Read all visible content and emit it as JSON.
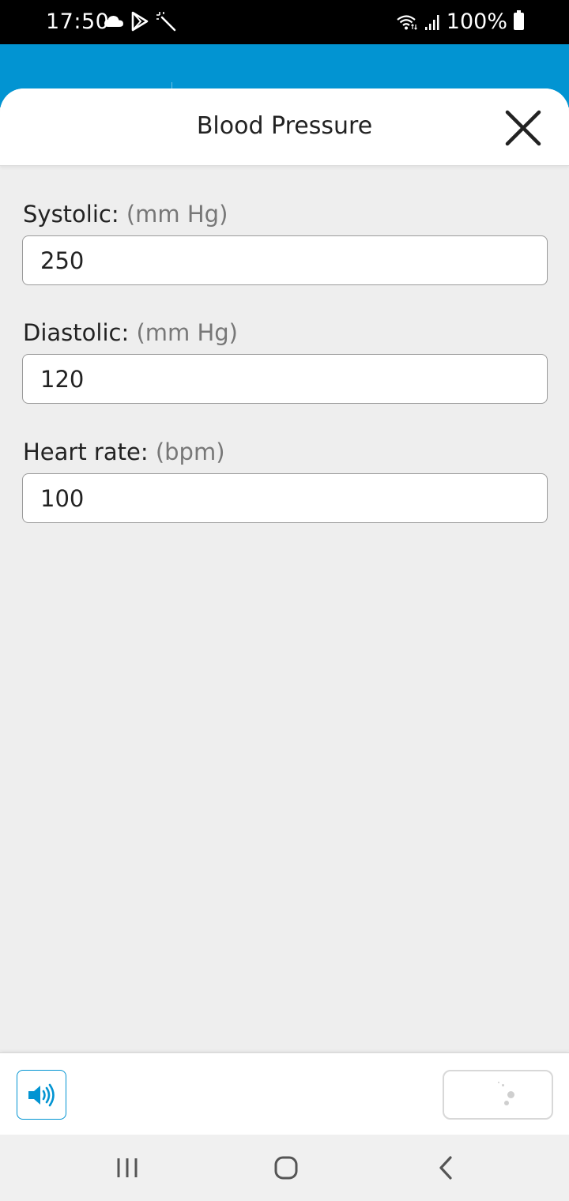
{
  "status_bar": {
    "time": "17:50",
    "battery": "100%",
    "left_icons": [
      "cloud-icon",
      "play-store-icon",
      "magic-wand-icon"
    ],
    "right_icons": [
      "wifi-icon",
      "signal-icon",
      "battery-icon"
    ]
  },
  "modal": {
    "title": "Blood Pressure",
    "close_icon": "close-icon"
  },
  "fields": [
    {
      "label": "Systolic:",
      "unit": "(mm Hg)",
      "value": "250"
    },
    {
      "label": "Diastolic:",
      "unit": "(mm Hg)",
      "value": "120"
    },
    {
      "label": "Heart rate:",
      "unit": "(bpm)",
      "value": "100"
    }
  ],
  "toolbar": {
    "audio_icon": "speaker-icon",
    "action_state": "loading",
    "accent_color": "#0294d2"
  },
  "nav": {
    "recents_icon": "recents-icon",
    "home_icon": "home-icon",
    "back_icon": "back-icon"
  }
}
